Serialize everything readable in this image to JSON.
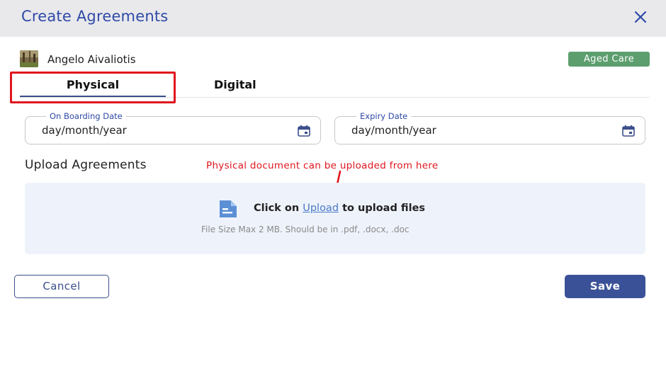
{
  "dialog": {
    "title": "Create Agreements"
  },
  "user": {
    "name": "Angelo Aivaliotis",
    "badge": "Aged Care"
  },
  "tabs": [
    {
      "label": "Physical",
      "active": true
    },
    {
      "label": "Digital",
      "active": false
    }
  ],
  "fields": {
    "onboarding": {
      "label": "On Boarding Date",
      "value": "day/month/year"
    },
    "expiry": {
      "label": "Expiry Date",
      "value": "day/month/year"
    }
  },
  "upload": {
    "section_title": "Upload Agreements",
    "annotation": "Physical document can be uploaded from here",
    "prefix": "Click on",
    "link": "Upload",
    "suffix": "to upload files",
    "hint": "File Size Max 2 MB. Should be in .pdf, .docx, .doc"
  },
  "buttons": {
    "cancel": "Cancel",
    "save": "Save"
  },
  "colors": {
    "accent": "#2f4aa6",
    "primary_button": "#3b5197",
    "badge": "#5c9e6e",
    "annotation": "#e0161e",
    "dropzone_bg": "#eef3fb"
  },
  "icons": [
    "close-icon",
    "calendar-icon",
    "document-icon"
  ]
}
